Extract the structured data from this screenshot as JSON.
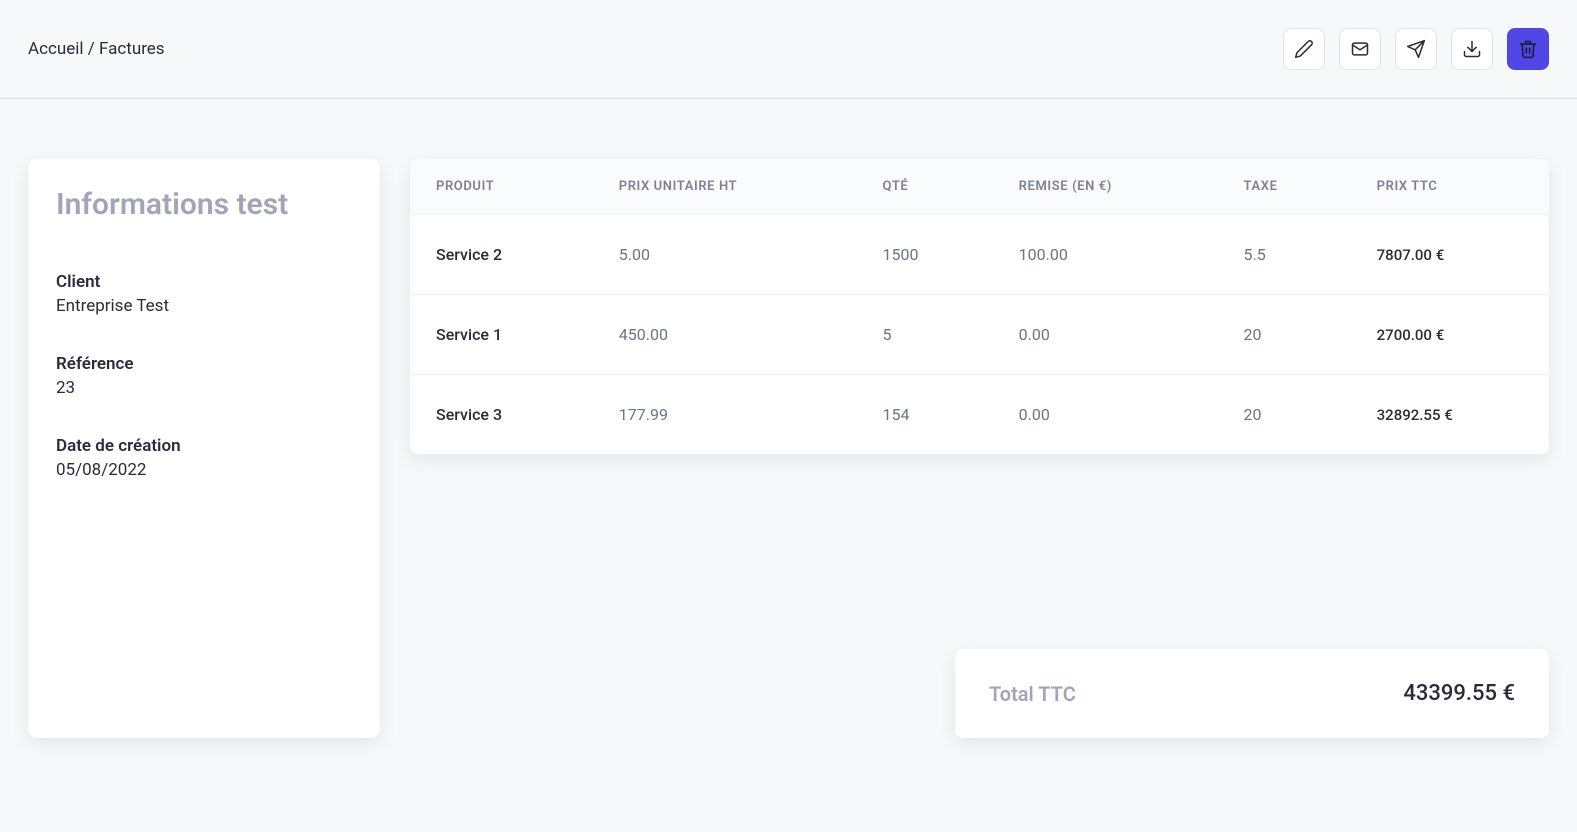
{
  "breadcrumb": {
    "home": "Accueil",
    "sep": " / ",
    "current": "Factures"
  },
  "info": {
    "title": "Informations test",
    "client_label": "Client",
    "client_value": "Entreprise Test",
    "ref_label": "Référence",
    "ref_value": "23",
    "date_label": "Date de création",
    "date_value": "05/08/2022"
  },
  "table": {
    "headers": {
      "product": "PRODUIT",
      "unit_price": "PRIX UNITAIRE HT",
      "qty": "QTÉ",
      "discount": "REMISE (EN €)",
      "tax": "TAXE",
      "price_ttc": "PRIX TTC"
    },
    "rows": [
      {
        "product": "Service 2",
        "unit_price": "5.00",
        "qty": "1500",
        "discount": "100.00",
        "tax": "5.5",
        "price_ttc": "7807.00 €"
      },
      {
        "product": "Service 1",
        "unit_price": "450.00",
        "qty": "5",
        "discount": "0.00",
        "tax": "20",
        "price_ttc": "2700.00 €"
      },
      {
        "product": "Service 3",
        "unit_price": "177.99",
        "qty": "154",
        "discount": "0.00",
        "tax": "20",
        "price_ttc": "32892.55 €"
      }
    ]
  },
  "total": {
    "label": "Total TTC",
    "value": "43399.55 €"
  }
}
